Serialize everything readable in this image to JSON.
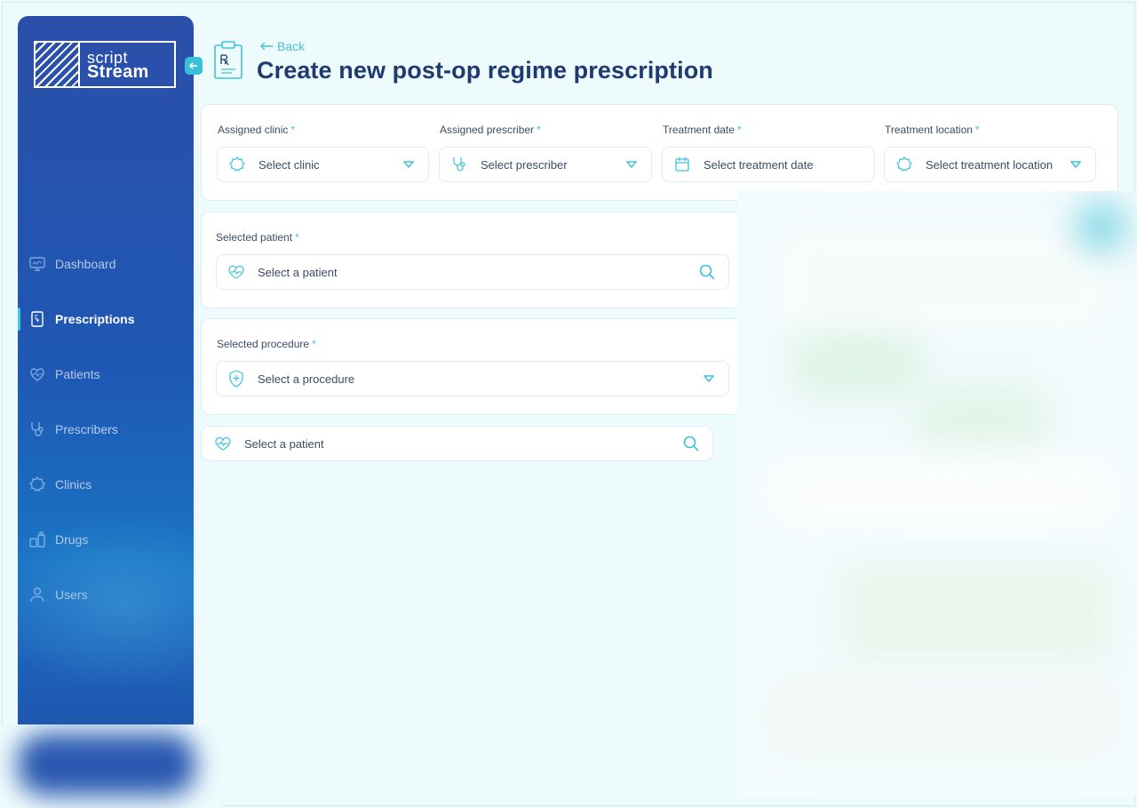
{
  "app": {
    "logo_line1": "script",
    "logo_line2": "Stream"
  },
  "sidebar": {
    "items": [
      {
        "label": "Dashboard",
        "icon": "monitor-icon"
      },
      {
        "label": "Prescriptions",
        "icon": "prescription-icon",
        "active": true
      },
      {
        "label": "Patients",
        "icon": "heart-pulse-icon"
      },
      {
        "label": "Prescribers",
        "icon": "stethoscope-icon"
      },
      {
        "label": "Clinics",
        "icon": "clinic-icon"
      },
      {
        "label": "Drugs",
        "icon": "pills-icon"
      },
      {
        "label": "Users",
        "icon": "user-icon"
      }
    ]
  },
  "header": {
    "back_label": "Back",
    "title": "Create new post-op regime prescription"
  },
  "form": {
    "assignment": {
      "clinic": {
        "label": "Assigned clinic",
        "placeholder": "Select clinic"
      },
      "prescriber": {
        "label": "Assigned prescriber",
        "placeholder": "Select prescriber"
      },
      "date": {
        "label": "Treatment date",
        "placeholder": "Select treatment date"
      },
      "location": {
        "label": "Treatment location",
        "placeholder": "Select treatment location"
      }
    },
    "patient": {
      "label": "Selected patient",
      "placeholder": "Select a patient"
    },
    "procedure": {
      "label": "Selected procedure",
      "placeholder": "Select a procedure"
    },
    "patient_search": {
      "placeholder": "Select a patient"
    }
  },
  "colors": {
    "accent": "#3ec3dd",
    "sidebar_top": "#2b4fa8",
    "title": "#1f3a6e",
    "background": "#eefbfd"
  }
}
